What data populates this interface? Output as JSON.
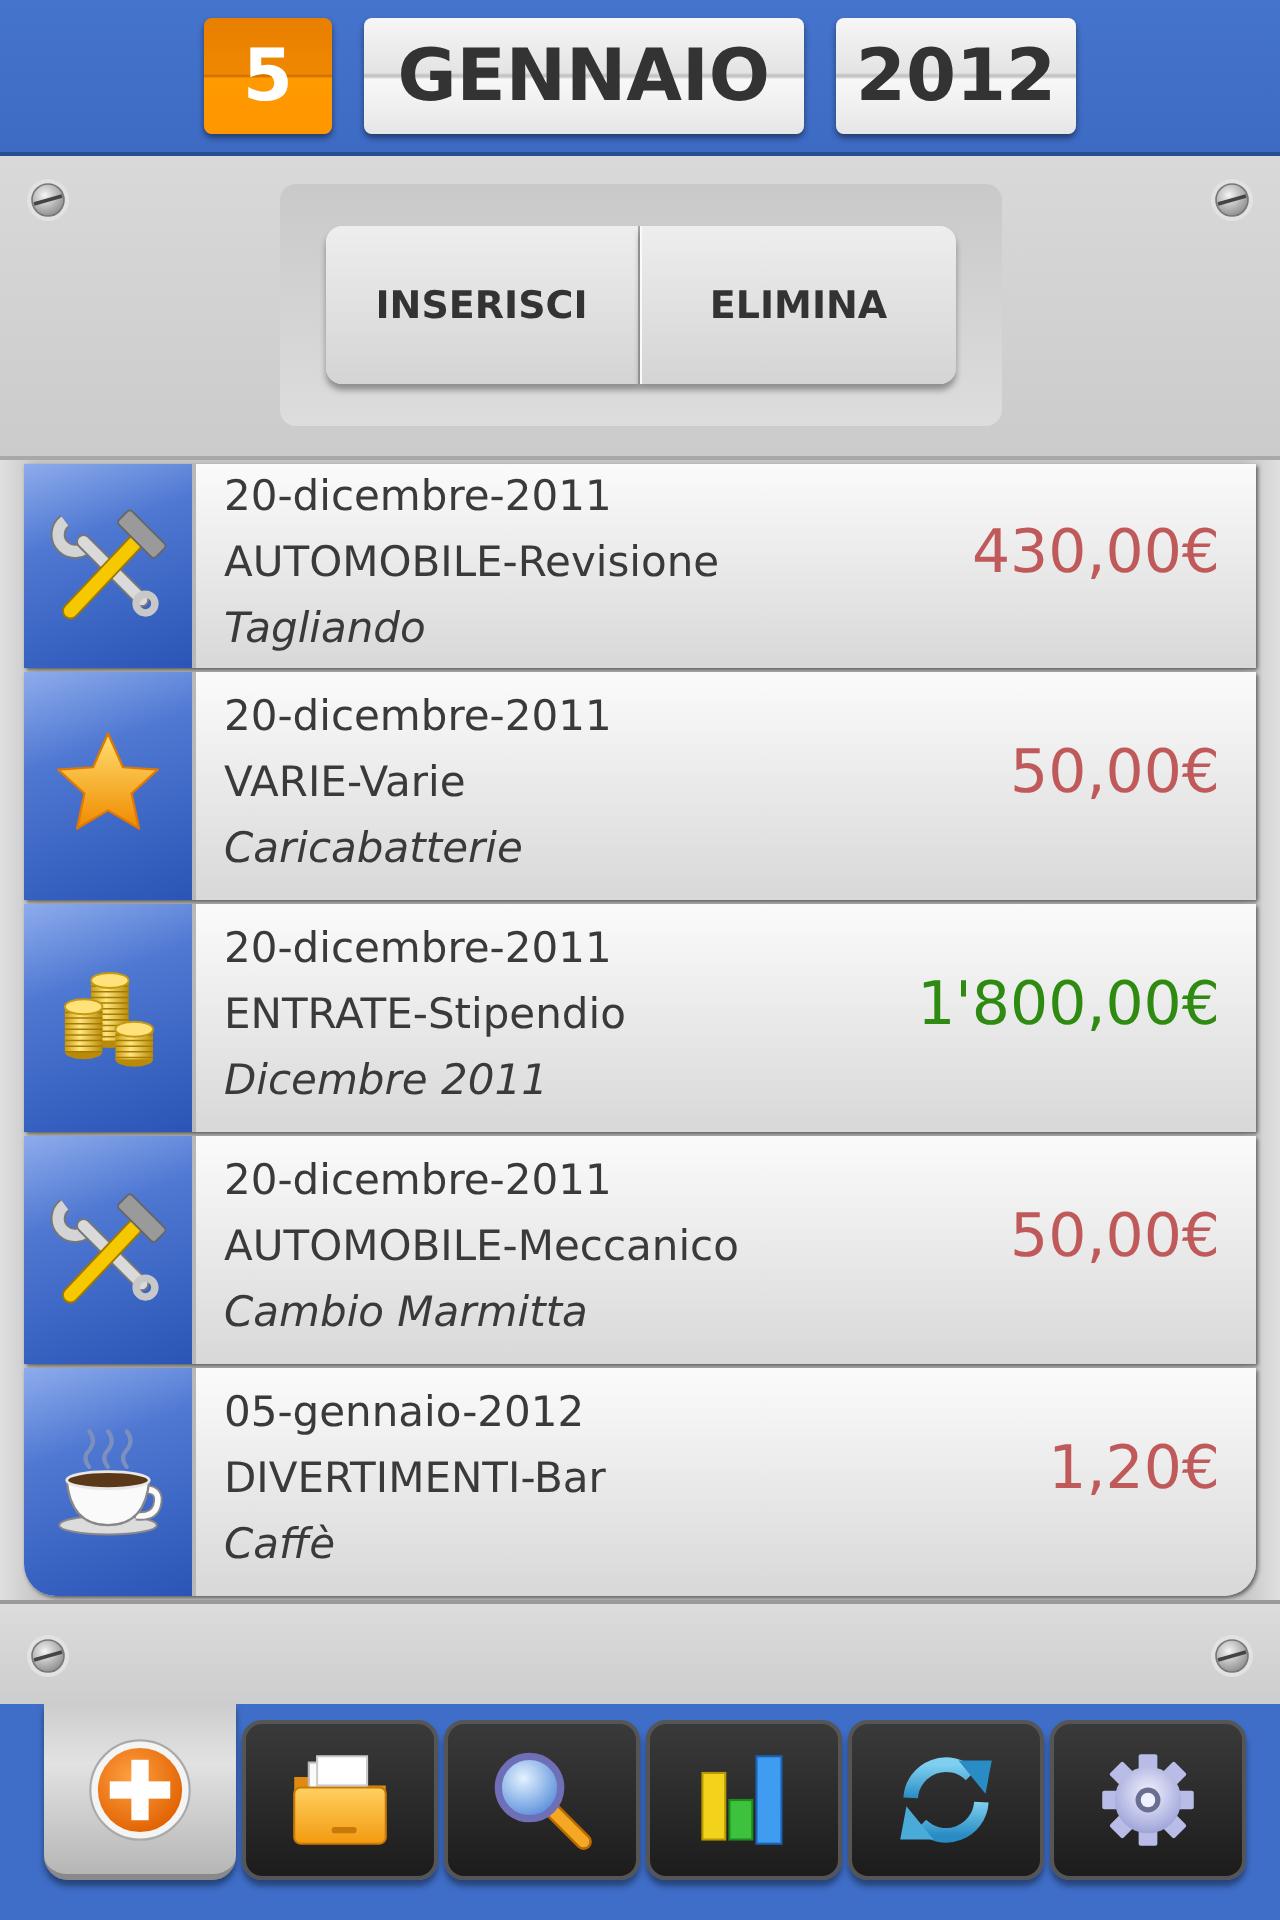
{
  "date": {
    "day": "5",
    "month": "GENNAIO",
    "year": "2012"
  },
  "actions": [
    "INSERISCI",
    "ELIMINA"
  ],
  "entries": [
    {
      "kind": "tools",
      "date": "20-dicembre-2011",
      "category": "AUTOMOBILE-Revisione",
      "note": "Tagliando",
      "amount": "430,00€",
      "color": "#c05a5a"
    },
    {
      "kind": "star",
      "date": "20-dicembre-2011",
      "category": "VARIE-Varie",
      "note": "Caricabatterie",
      "amount": "50,00€",
      "color": "#c05a5a"
    },
    {
      "kind": "coins",
      "date": "20-dicembre-2011",
      "category": "ENTRATE-Stipendio",
      "note": "Dicembre 2011",
      "amount": "1'800,00€",
      "color": "#2f8a12"
    },
    {
      "kind": "tools",
      "date": "20-dicembre-2011",
      "category": "AUTOMOBILE-Meccanico",
      "note": "Cambio Marmitta",
      "amount": "50,00€",
      "color": "#c05a5a"
    },
    {
      "kind": "cup",
      "date": "05-gennaio-2012",
      "category": "DIVERTIMENTI-Bar",
      "note": "Caffè",
      "amount": "1,20€",
      "color": "#c05a5a"
    }
  ],
  "tabs": [
    {
      "kind": "add",
      "selected": true
    },
    {
      "kind": "folder",
      "selected": false
    },
    {
      "kind": "search",
      "selected": false
    },
    {
      "kind": "chart",
      "selected": false
    },
    {
      "kind": "sync",
      "selected": false
    },
    {
      "kind": "gear",
      "selected": false
    }
  ]
}
